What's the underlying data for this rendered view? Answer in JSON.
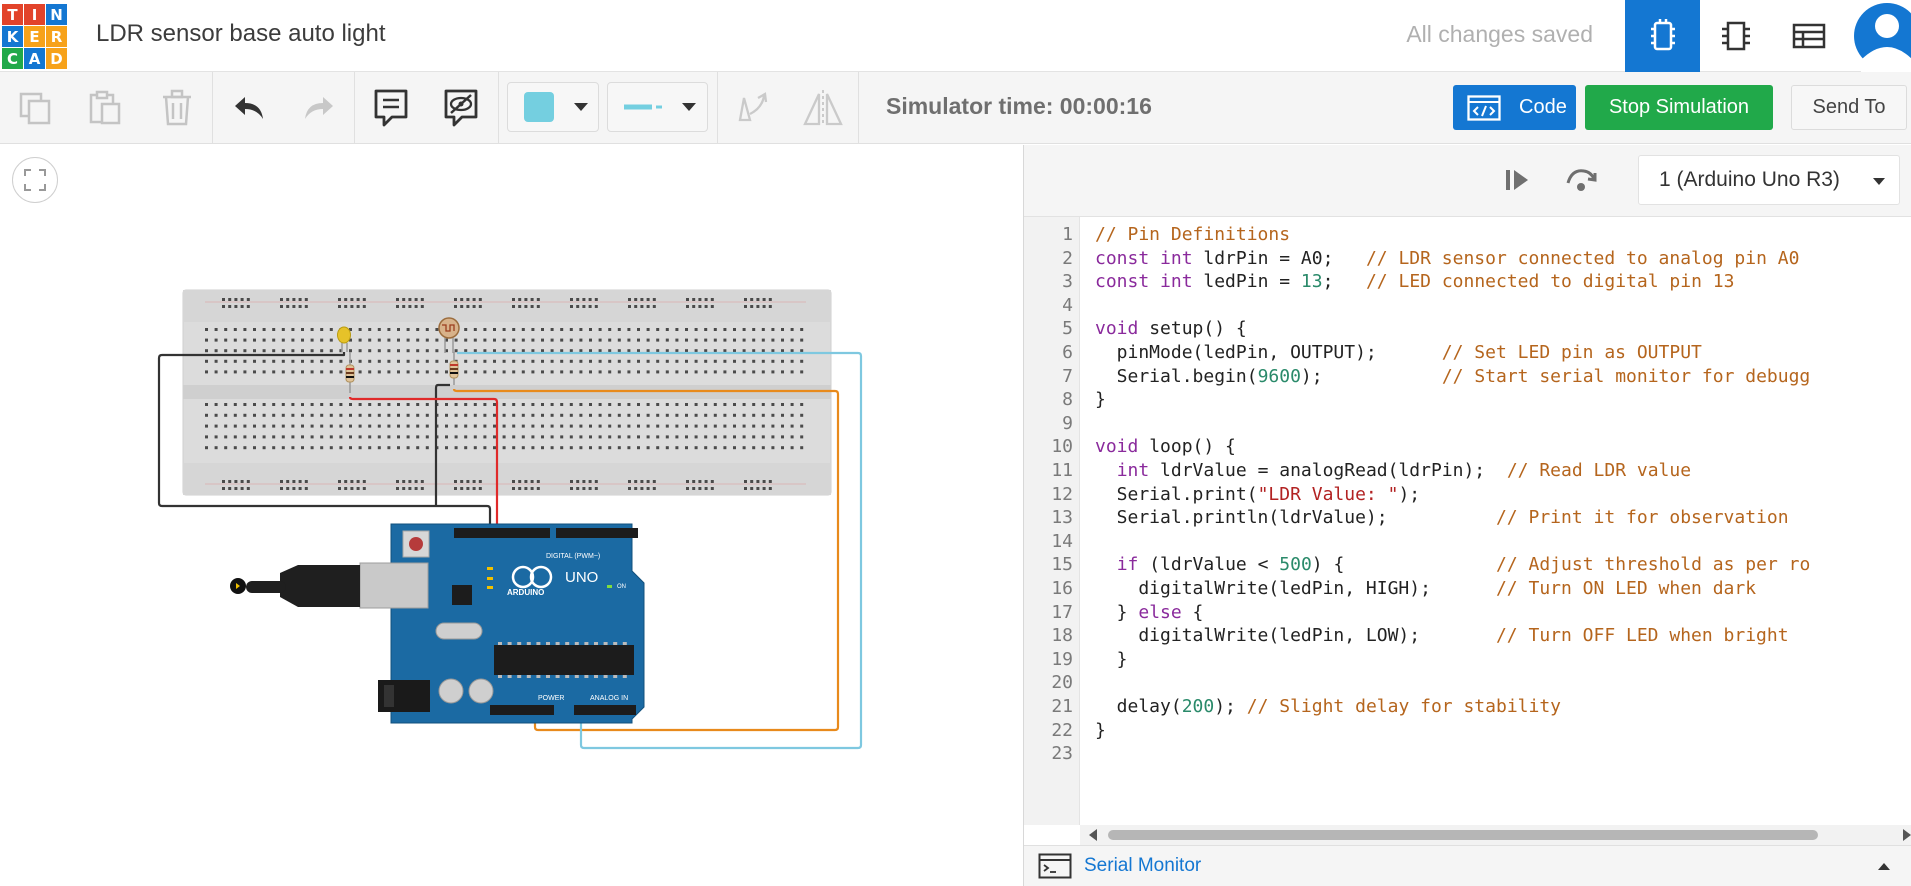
{
  "header": {
    "logo_letters": [
      "T",
      "I",
      "N",
      "K",
      "E",
      "R",
      "C",
      "A",
      "D"
    ],
    "logo_colors": [
      "#e2432a",
      "#e2432a",
      "#1477d2",
      "#1477d2",
      "#f7a21a",
      "#f7a21a",
      "#21a94a",
      "#1477d2",
      "#f7a21a"
    ],
    "project_title": "LDR sensor base auto light",
    "save_status": "All changes saved",
    "views": [
      "circuit-view-icon",
      "schematic-view-icon",
      "component-list-icon"
    ],
    "accent_color": "#1477d2"
  },
  "toolbar": {
    "tools": [
      "copy-icon",
      "paste-icon",
      "delete-icon",
      "undo-icon",
      "redo-icon",
      "notes-icon",
      "toggle-notes-icon",
      "color-swatch",
      "wire-style",
      "rotate-icon",
      "mirror-icon"
    ],
    "wire_color": "#74cfe0",
    "simulator_time": "Simulator time: 00:00:16",
    "code_label": "Code",
    "stop_label": "Stop Simulation",
    "send_label": "Send To"
  },
  "canvas": {
    "board_label": "UNO",
    "board_brand": "ARDUINO",
    "digital_label": "DIGITAL (PWM~)",
    "power_label": "POWER",
    "analog_label": "ANALOG IN",
    "on_label": "ON",
    "wire_colors": {
      "ground": "#333333",
      "power": "#e02a2a",
      "signal_orange": "#e88a1c",
      "signal_blue": "#7ec8e0"
    }
  },
  "code_panel": {
    "device": "1 (Arduino Uno R3)",
    "serial_monitor_label": "Serial Monitor",
    "lines": [
      "// Pin Definitions",
      "const int ldrPin = A0;   // LDR sensor connected to analog pin A0",
      "const int ledPin = 13;   // LED connected to digital pin 13",
      "",
      "void setup() {",
      "  pinMode(ledPin, OUTPUT);      // Set LED pin as OUTPUT",
      "  Serial.begin(9600);           // Start serial monitor for debugg",
      "}",
      "",
      "void loop() {",
      "  int ldrValue = analogRead(ldrPin);  // Read LDR value",
      "  Serial.print(\"LDR Value: \");",
      "  Serial.println(ldrValue);          // Print it for observation",
      "",
      "  if (ldrValue < 500) {              // Adjust threshold as per ro",
      "    digitalWrite(ledPin, HIGH);      // Turn ON LED when dark",
      "  } else {",
      "    digitalWrite(ledPin, LOW);       // Turn OFF LED when bright",
      "  }",
      "",
      "  delay(200); // Slight delay for stability",
      "}",
      ""
    ]
  }
}
